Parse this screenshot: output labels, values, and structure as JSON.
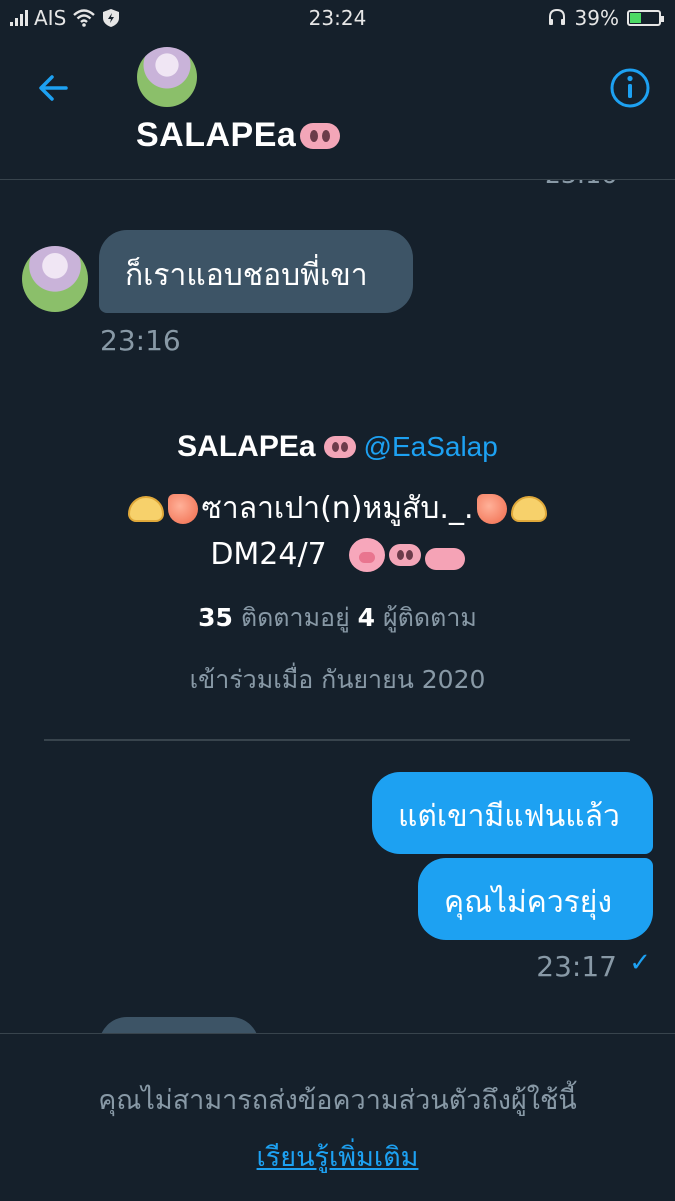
{
  "status_bar": {
    "carrier": "AIS",
    "time": "23:24",
    "battery_percent": "39%",
    "battery_level": 0.39
  },
  "header": {
    "name": "SALAPEa",
    "name_emoji": "pig-nose",
    "back_icon": "arrow-left-icon",
    "info_icon": "info-icon"
  },
  "conversation": {
    "partial_time": "23:16",
    "incoming": {
      "text": "ก็เราแอบชอบพี่เขา",
      "time": "23:16"
    },
    "profile_card": {
      "name": "SALAPEa",
      "handle": "@EaSalap",
      "bio_line1": "ซาลาเปา(n)หมูสับ._.",
      "bio_line2": "DM24/7",
      "following_count": "35",
      "following_label": "ติดตามอยู่",
      "followers_count": "4",
      "followers_label": "ผู้ติดตาม",
      "joined": "เข้าร่วมเมื่อ กันยายน 2020"
    },
    "outgoing": [
      {
        "text": "แต่เขามีแฟนแล้ว"
      },
      {
        "text": "คุณไม่ควรยุ่ง"
      }
    ],
    "outgoing_time": "23:17"
  },
  "footer": {
    "message": "คุณไม่สามารถส่งข้อความส่วนตัวถึงผู้ใช้นี้",
    "link": "เรียนรู้เพิ่มเติม"
  },
  "colors": {
    "background": "#15202b",
    "accent": "#1da1f2",
    "incoming_bubble": "#3d5466",
    "muted_text": "#8899a6"
  }
}
